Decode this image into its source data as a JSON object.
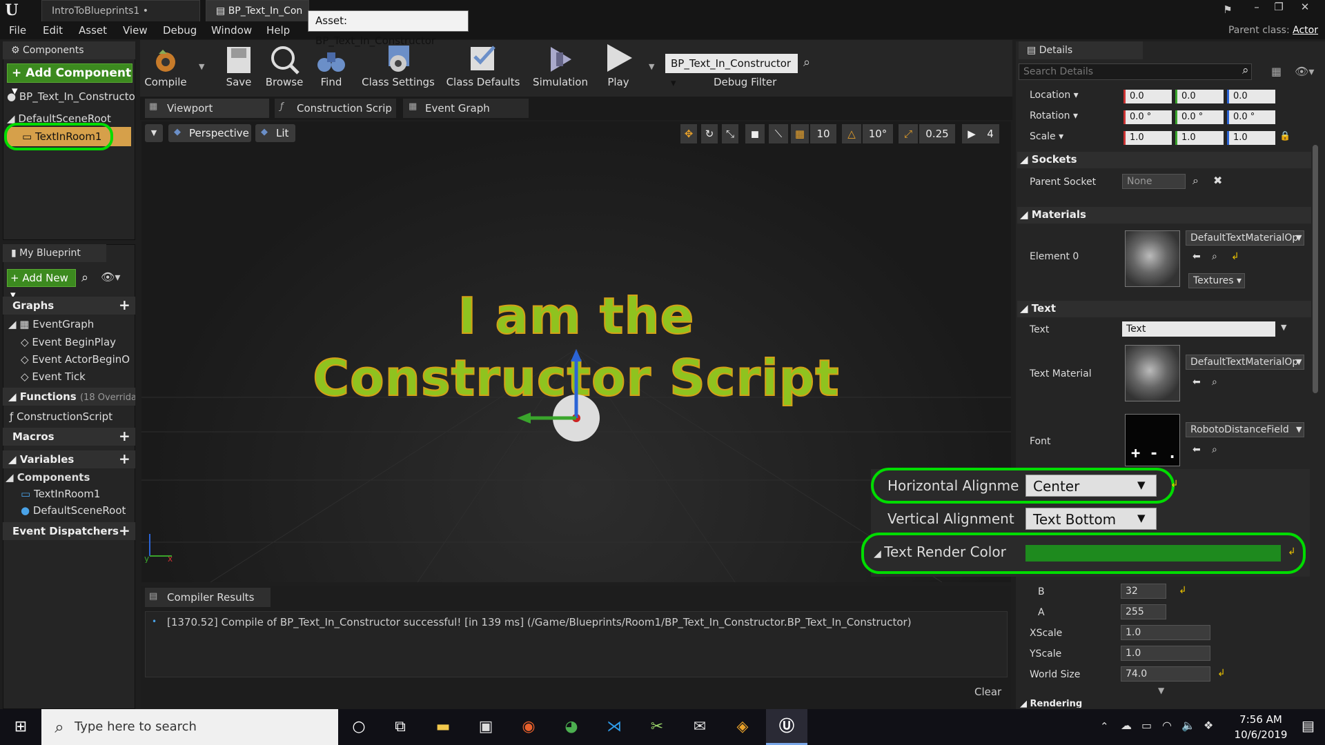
{
  "window": {
    "tab1": "IntroToBlueprints1",
    "tab2": "BP_Text_In_Con",
    "tooltip": "Asset: BP_Text_In_Constructor",
    "parent_class_label": "Parent class:",
    "parent_class_value": "Actor"
  },
  "menu": [
    "File",
    "Edit",
    "Asset",
    "View",
    "Debug",
    "Window",
    "Help"
  ],
  "components": {
    "title": "Components",
    "add_label": "+ Add Component",
    "items": [
      "BP_Text_In_Constructo",
      "DefaultSceneRoot",
      "TextInRoom1"
    ]
  },
  "toolbar": {
    "compile": "Compile",
    "save": "Save",
    "browse": "Browse",
    "find": "Find",
    "class_settings": "Class Settings",
    "class_defaults": "Class Defaults",
    "simulation": "Simulation",
    "play": "Play",
    "debug_select": "BP_Text_In_Constructor",
    "debug_filter": "Debug Filter"
  },
  "editor_tabs": [
    "Viewport",
    "Construction Scrip",
    "Event Graph"
  ],
  "viewport": {
    "perspective": "Perspective",
    "lit": "Lit",
    "grid_snap": "10",
    "rot_snap": "10°",
    "scale_snap": "0.25",
    "cam_speed": "4",
    "text_line1": "I am the",
    "text_line2": "Constructor Script"
  },
  "my_blueprint": {
    "title": "My Blueprint",
    "add_new": "+ Add New",
    "graphs": "Graphs",
    "event_graph": "EventGraph",
    "events": [
      "Event BeginPlay",
      "Event ActorBeginO",
      "Event Tick"
    ],
    "functions": "Functions",
    "functions_note": "(18 Overrida",
    "construction_script": "ConstructionScript",
    "macros": "Macros",
    "variables": "Variables",
    "var_components": "Components",
    "var_items": [
      "TextInRoom1",
      "DefaultSceneRoot"
    ],
    "dispatchers": "Event Dispatchers"
  },
  "compiler": {
    "title": "Compiler Results",
    "message": "[1370.52] Compile of BP_Text_In_Constructor successful! [in 139 ms] (/Game/Blueprints/Room1/BP_Text_In_Constructor.BP_Text_In_Constructor)",
    "clear": "Clear"
  },
  "details": {
    "title": "Details",
    "search_placeholder": "Search Details",
    "location_label": "Location",
    "location": [
      "0.0",
      "0.0",
      "0.0"
    ],
    "rotation_label": "Rotation",
    "rotation": [
      "0.0 °",
      "0.0 °",
      "0.0 °"
    ],
    "scale_label": "Scale",
    "scale": [
      "1.0",
      "1.0",
      "1.0"
    ],
    "sockets": "Sockets",
    "parent_socket_label": "Parent Socket",
    "parent_socket": "None",
    "materials": "Materials",
    "element0": "Element 0",
    "material_name": "DefaultTextMaterialOp",
    "textures": "Textures",
    "text_section": "Text",
    "text_label": "Text",
    "text_value": "Text",
    "text_material_label": "Text Material",
    "text_material": "DefaultTextMaterialOp",
    "font_label": "Font",
    "font": "RobotoDistanceField",
    "b_label": "B",
    "b_value": "32",
    "a_label": "A",
    "a_value": "255",
    "xscale_label": "XScale",
    "xscale": "1.0",
    "yscale_label": "YScale",
    "yscale": "1.0",
    "world_size_label": "World Size",
    "world_size": "74.0",
    "rendering": "Rendering"
  },
  "overlay": {
    "h_align_label": "Horizontal Alignme",
    "h_align": "Center",
    "v_align_label": "Vertical Alignment",
    "v_align": "Text Bottom",
    "color_label": "Text Render Color",
    "color_value": "#1e8a1e"
  },
  "taskbar": {
    "search": "Type here to search",
    "time": "7:56 AM",
    "date": "10/6/2019"
  },
  "colors": {
    "accent_green": "#00dc00",
    "text_green": "#8fc31f",
    "text_outline": "#d4a017"
  }
}
